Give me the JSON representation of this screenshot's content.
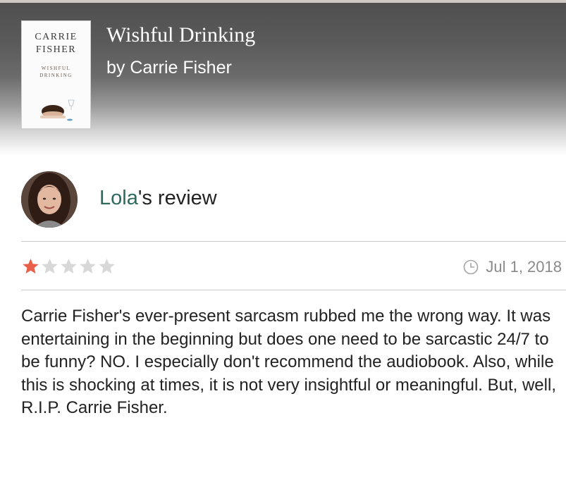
{
  "book": {
    "title": "Wishful Drinking",
    "byline": "by Carrie Fisher",
    "cover": {
      "author_line1": "CARRIE",
      "author_line2": "FISHER",
      "title_line1": "WISHFUL",
      "title_line2": "DRINKING"
    }
  },
  "review": {
    "reviewer_name": "Lola",
    "heading_suffix": "'s review",
    "rating": 1,
    "rating_max": 5,
    "date": "Jul 1, 2018",
    "body": "Carrie Fisher's ever-present sarcasm rubbed me the wrong way. It was entertaining in the beginning but does one need to be sarcastic 24/7 to be funny? NO. I especially don't recommend the audiobook. Also, while this is shocking at times, it is not very insightful or meaningful. But, well, R.I.P. Carrie Fisher."
  },
  "colors": {
    "star_filled": "#e8604a",
    "star_empty": "#d8d8d8",
    "reviewer_name": "#2b6a5c"
  },
  "icons": {
    "date": "clock-icon",
    "rating": "star-icon"
  }
}
